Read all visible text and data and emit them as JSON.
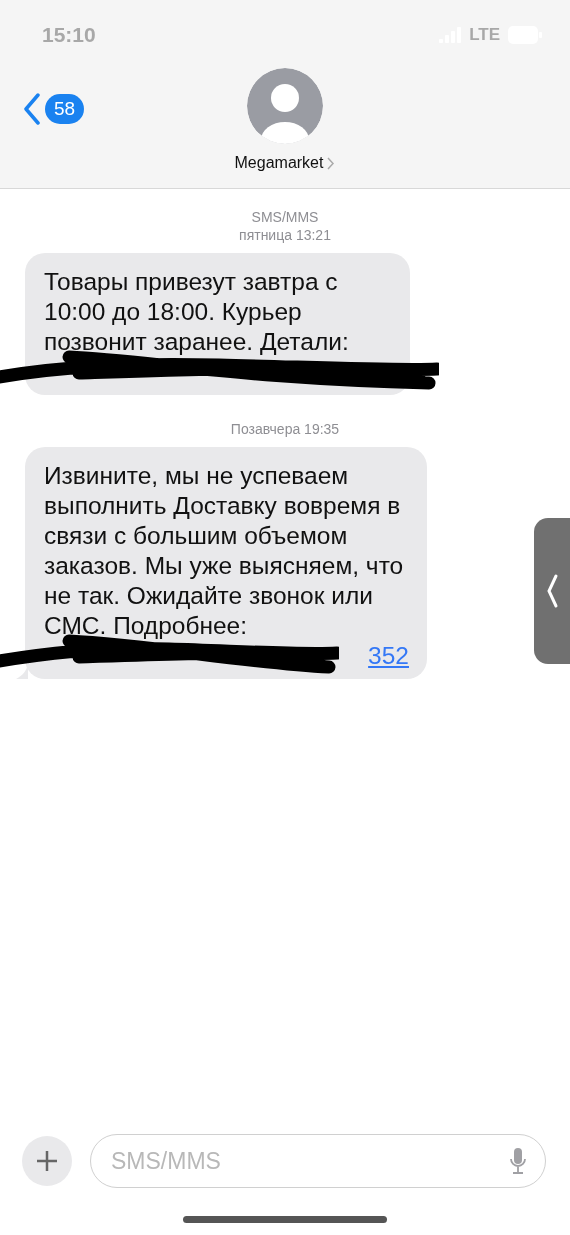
{
  "status_bar": {
    "time": "15:10",
    "network": "LTE"
  },
  "header": {
    "back_count": "58",
    "contact": "Megamarket"
  },
  "thread": [
    {
      "kind": "service",
      "label": "SMS/MMS"
    },
    {
      "kind": "time",
      "label": "пятница 13:21"
    },
    {
      "kind": "message",
      "text": "Товары привезут завтра с 10:00 до 18:00. Курьер позвонит заранее. Детали:",
      "tail": false
    },
    {
      "kind": "time",
      "label": "Позавчера 19:35"
    },
    {
      "kind": "message",
      "text": "Извините, мы не успеваем выполнить Доставку вовремя в связи с большим объемом заказов. Мы уже выясняем, что не так. Ожидайте звонок или СМС. Подробнее:",
      "link": "352",
      "tail": true
    }
  ],
  "composer": {
    "placeholder": "SMS/MMS"
  }
}
